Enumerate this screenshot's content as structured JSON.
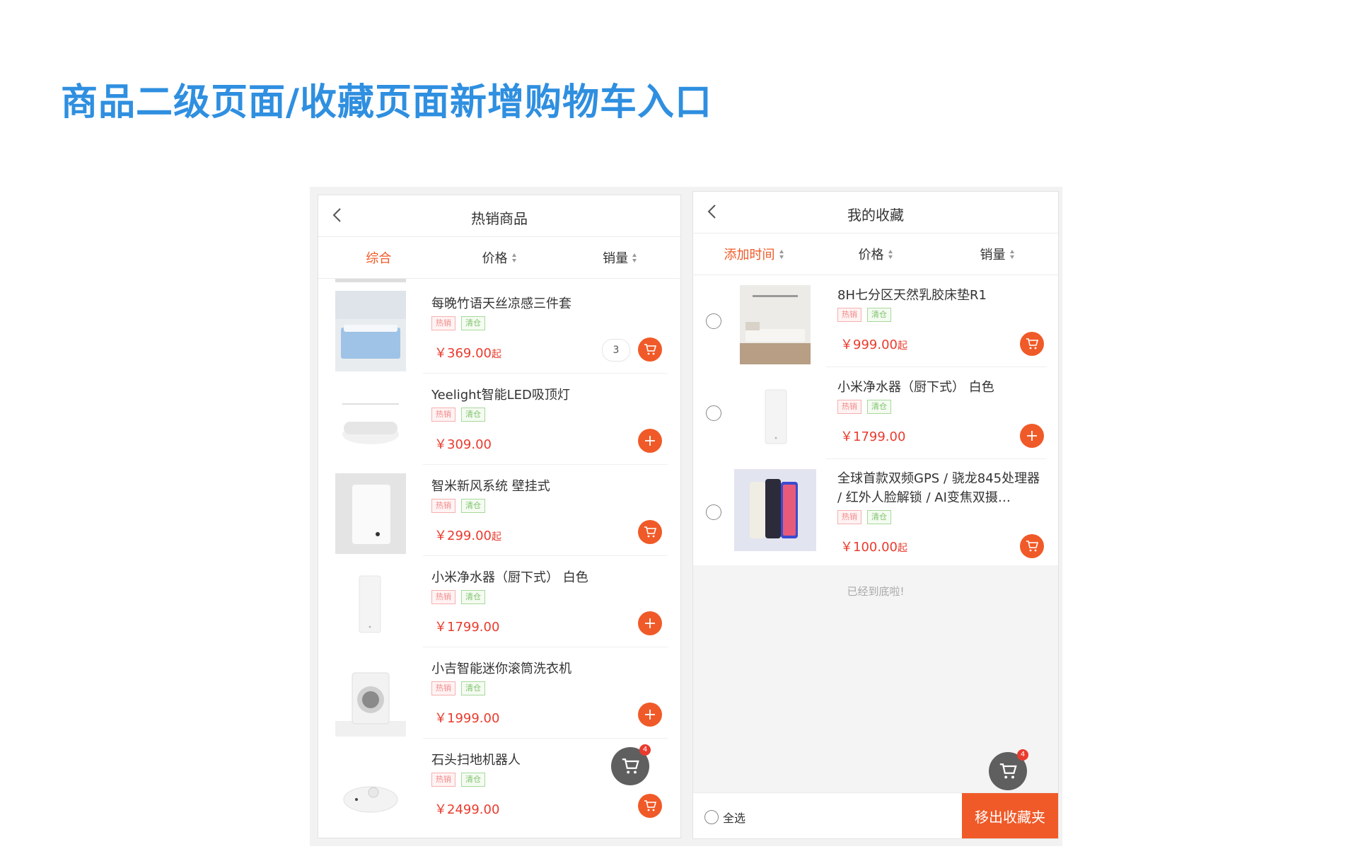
{
  "page": {
    "title": "商品二级页面/收藏页面新增购物车入口"
  },
  "colors": {
    "accent": "#f05a28",
    "price": "#e93b2d",
    "title": "#2f8fe0"
  },
  "hot_products": {
    "nav_title": "热销商品",
    "back_icon": "chevron-left-icon",
    "sort": [
      {
        "label": "综合",
        "active": true
      },
      {
        "label": "价格",
        "active": false
      },
      {
        "label": "销量",
        "active": false
      }
    ],
    "items": [
      {
        "name": "每晚竹语天丝凉感三件套",
        "tags": [
          "热销",
          "清仓"
        ],
        "price": "￥369.00",
        "suffix": "起",
        "action": "cart-icon",
        "quantity": "3"
      },
      {
        "name": "Yeelight智能LED吸顶灯",
        "tags": [
          "热销",
          "清仓"
        ],
        "price": "￥309.00",
        "suffix": "",
        "action": "plus-icon"
      },
      {
        "name": "智米新风系统 壁挂式",
        "tags": [
          "热销",
          "清仓"
        ],
        "price": "￥299.00",
        "suffix": "起",
        "action": "cart-icon"
      },
      {
        "name": "小米净水器（厨下式） 白色",
        "tags": [
          "热销",
          "清仓"
        ],
        "price": "￥1799.00",
        "suffix": "",
        "action": "plus-icon"
      },
      {
        "name": "小吉智能迷你滚筒洗衣机",
        "tags": [
          "热销",
          "清仓"
        ],
        "price": "￥1999.00",
        "suffix": "",
        "action": "plus-icon"
      },
      {
        "name": "石头扫地机器人",
        "tags": [
          "热销",
          "清仓"
        ],
        "price": "￥2499.00",
        "suffix": "",
        "action": "cart-icon"
      }
    ],
    "float_cart": {
      "count": "4"
    }
  },
  "favorites": {
    "nav_title": "我的收藏",
    "back_icon": "chevron-left-icon",
    "sort": [
      {
        "label": "添加时间",
        "active": true
      },
      {
        "label": "价格",
        "active": false
      },
      {
        "label": "销量",
        "active": false
      }
    ],
    "items": [
      {
        "name": "8H七分区天然乳胶床垫R1",
        "tags": [
          "热销",
          "清仓"
        ],
        "price": "￥999.00",
        "suffix": "起",
        "action": "cart-icon"
      },
      {
        "name": "小米净水器（厨下式） 白色",
        "tags": [
          "热销",
          "清仓"
        ],
        "price": "￥1799.00",
        "suffix": "",
        "action": "plus-icon"
      },
      {
        "name": "全球首款双频GPS / 骁龙845处理器 / 红外人脸解锁 / AI变焦双摄…",
        "tags": [
          "热销",
          "清仓"
        ],
        "price": "￥100.00",
        "suffix": "起",
        "action": "cart-icon"
      }
    ],
    "end_text": "已经到底啦!",
    "select_all_label": "全选",
    "remove_button": "移出收藏夹",
    "float_cart": {
      "count": "4"
    }
  }
}
